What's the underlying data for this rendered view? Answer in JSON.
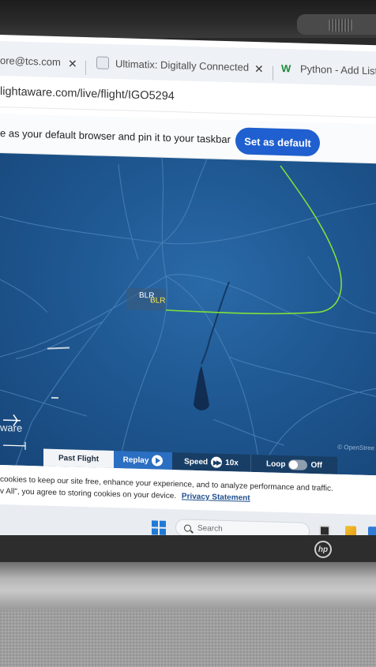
{
  "browser": {
    "tabs": [
      {
        "label": "ore@tcs.com"
      },
      {
        "label": "Ultimatix: Digitally Connected"
      },
      {
        "label": "Python - Add List I"
      }
    ],
    "address": "lightaware.com/live/flight/IGO5294"
  },
  "default_banner": {
    "message": "e as your default browser and pin it to your taskbar",
    "button": "Set as default",
    "button_color": "#1f5fcf"
  },
  "map": {
    "airport_code_white": "BLR",
    "airport_code_yellow": "BLR",
    "brand_fragment": "ware",
    "attribution": "© OpenStree",
    "route_color": "#7ee03a"
  },
  "controls": {
    "past_flight": "Past Flight",
    "replay": "Replay",
    "speed_label": "Speed",
    "speed_value": "10x",
    "loop_label": "Loop",
    "loop_state": "Off"
  },
  "cookie": {
    "line1": "cookies to keep our site free, enhance your experience, and to analyze performance and traffic.",
    "line2": "v All\", you agree to storing cookies on your device.",
    "link": "Privacy Statement"
  },
  "taskbar": {
    "search_placeholder": "Search"
  },
  "device": {
    "logo": "hp"
  }
}
